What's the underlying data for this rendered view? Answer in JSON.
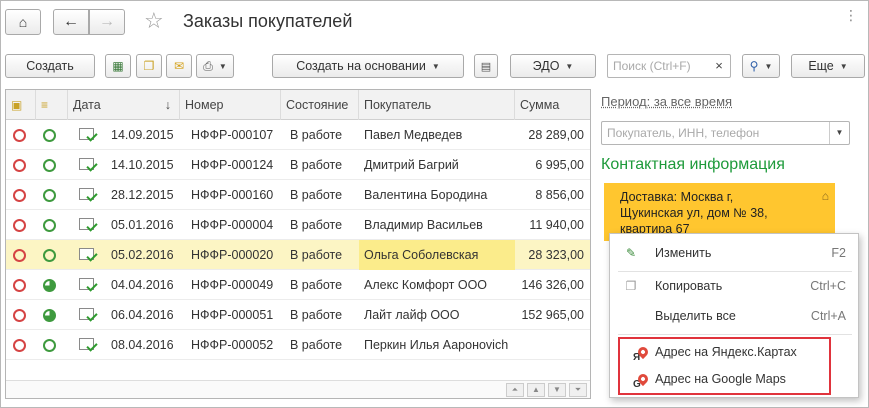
{
  "window": {
    "title": "Заказы покупателей"
  },
  "toolbar": {
    "create_label": "Создать",
    "create_based_label": "Создать на основании",
    "edo_label": "ЭДО",
    "more_label": "Еще",
    "search_placeholder": "Поиск (Ctrl+F)"
  },
  "table": {
    "columns": [
      "Дата",
      "Номер",
      "Состояние",
      "Покупатель",
      "Сумма"
    ],
    "sort_indicator": "↓",
    "rows": [
      {
        "date": "14.09.2015",
        "number": "НФФР-000107",
        "state": "В работе",
        "buyer": "Павел Медведев",
        "sum": "28 289,00",
        "status2": "green"
      },
      {
        "date": "14.10.2015",
        "number": "НФФР-000124",
        "state": "В работе",
        "buyer": "Дмитрий Багрий",
        "sum": "6 995,00",
        "status2": "green"
      },
      {
        "date": "28.12.2015",
        "number": "НФФР-000160",
        "state": "В работе",
        "buyer": "Валентина Бородина",
        "sum": "8 856,00",
        "status2": "green"
      },
      {
        "date": "05.01.2016",
        "number": "НФФР-000004",
        "state": "В работе",
        "buyer": "Владимир Васильев",
        "sum": "11 940,00",
        "status2": "green"
      },
      {
        "date": "05.02.2016",
        "number": "НФФР-000020",
        "state": "В работе",
        "buyer": "Ольга Соболевская",
        "sum": "28 323,00",
        "status2": "green"
      },
      {
        "date": "04.04.2016",
        "number": "НФФР-000049",
        "state": "В работе",
        "buyer": "Алекс Комфорт ООО",
        "sum": "146 326,00",
        "status2": "half"
      },
      {
        "date": "06.04.2016",
        "number": "НФФР-000051",
        "state": "В работе",
        "buyer": "Лайт лайф ООО",
        "sum": "152 965,00",
        "status2": "half"
      },
      {
        "date": "08.04.2016",
        "number": "НФФР-000052",
        "state": "В работе",
        "buyer": "Перкин Илья Аароноvich",
        "sum": "",
        "status2": "green"
      }
    ]
  },
  "side": {
    "period_label": "Период: за все время",
    "buyer_placeholder": "Покупатель, ИНН, телефон",
    "contact_title": "Контактная информация",
    "address_lines": [
      "Доставка: Москва г,",
      "Щукинская ул, дом № 38,",
      "квартира 67"
    ]
  },
  "context_menu": {
    "items": [
      {
        "label": "Изменить",
        "shortcut": "F2",
        "icon": "pencil-icon"
      },
      {
        "label": "Копировать",
        "shortcut": "Ctrl+C",
        "icon": "copy-icon"
      },
      {
        "label": "Выделить все",
        "shortcut": "Ctrl+A",
        "icon": ""
      },
      {
        "label": "Адрес на Яндекс.Картах",
        "shortcut": "",
        "icon": "yandex-map-pin-icon",
        "letter": "Я"
      },
      {
        "label": "Адрес на Google Maps",
        "shortcut": "",
        "icon": "google-map-pin-icon",
        "letter": "G"
      }
    ]
  },
  "colors": {
    "accent_green": "#1d9a3a",
    "address_bg": "#ffc62f",
    "highlight_row": "#fcf5c4",
    "red_box": "#e0333c"
  }
}
